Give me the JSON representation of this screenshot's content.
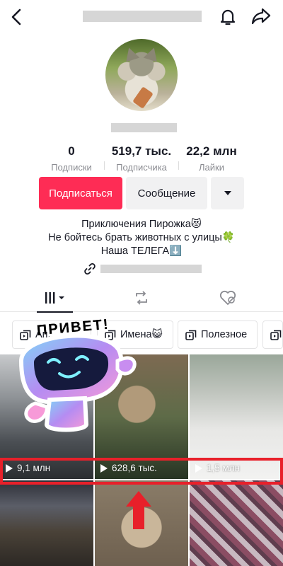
{
  "stats": [
    {
      "value": "0",
      "label": "Подписки"
    },
    {
      "value": "519,7 тыс.",
      "label": "Подписчика"
    },
    {
      "value": "22,2 млн",
      "label": "Лайки"
    }
  ],
  "actions": {
    "follow_label": "Подписаться",
    "message_label": "Сообщение"
  },
  "bio": {
    "line1": "Приключения Пирожка😻",
    "line2": "Не бойтесь брать животных с улицы🍀",
    "line3": "Наша ТЕЛЕГА⬇️"
  },
  "tabs": [
    "videos-grid-icon",
    "repost-icon",
    "liked-hidden-icon"
  ],
  "playlists": [
    {
      "label": "Ап..."
    },
    {
      "label": "Имена😺"
    },
    {
      "label": "Полезное"
    },
    {
      "label": ""
    }
  ],
  "videos": [
    {
      "views": "9,1 млн"
    },
    {
      "views": "628,6 тыс."
    },
    {
      "views": "1,5 млн"
    },
    {
      "views": ""
    },
    {
      "views": ""
    },
    {
      "views": ""
    }
  ],
  "sticker": {
    "text": "ПРИВЕТ!"
  },
  "colors": {
    "accent": "#fe2c55",
    "annotation": "#e8202a",
    "secondary_button": "#f1f1f2",
    "muted_text": "#8a8b91"
  }
}
